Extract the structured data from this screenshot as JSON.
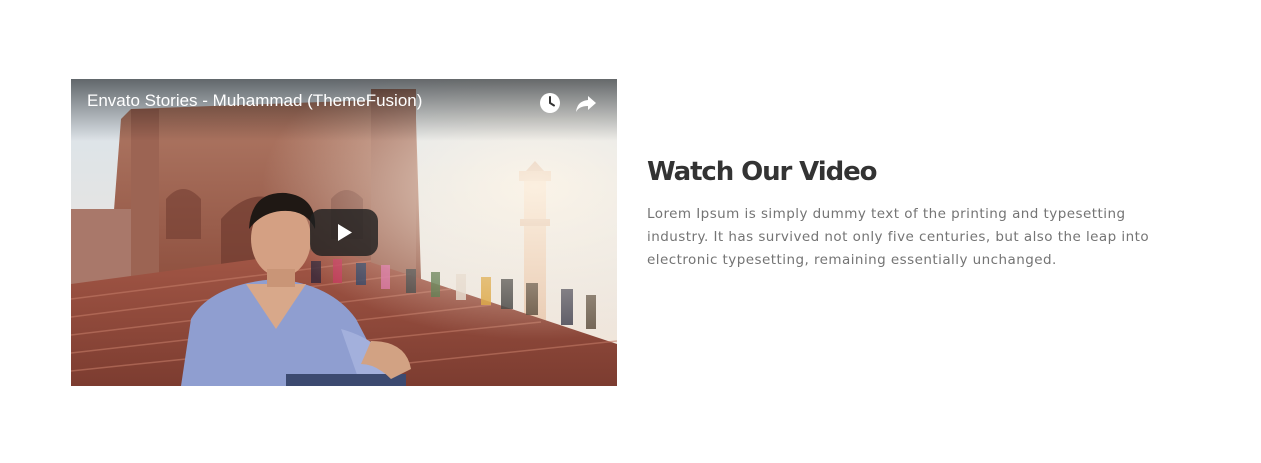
{
  "video": {
    "title": "Envato Stories - Muhammad (ThemeFusion)",
    "controls": {
      "watch_later_icon": "clock-icon",
      "share_icon": "share-arrow-icon",
      "play_icon": "play-icon"
    }
  },
  "section": {
    "heading": "Watch Our Video",
    "lines": [
      "Lorem Ipsum is simply dummy text of the printing and typesetting",
      "industry. It has survived not only five centuries, but also the leap into",
      "electronic typesetting, remaining essentially unchanged."
    ]
  },
  "colors": {
    "heading": "#333333",
    "body": "#747474",
    "background": "#ffffff"
  }
}
